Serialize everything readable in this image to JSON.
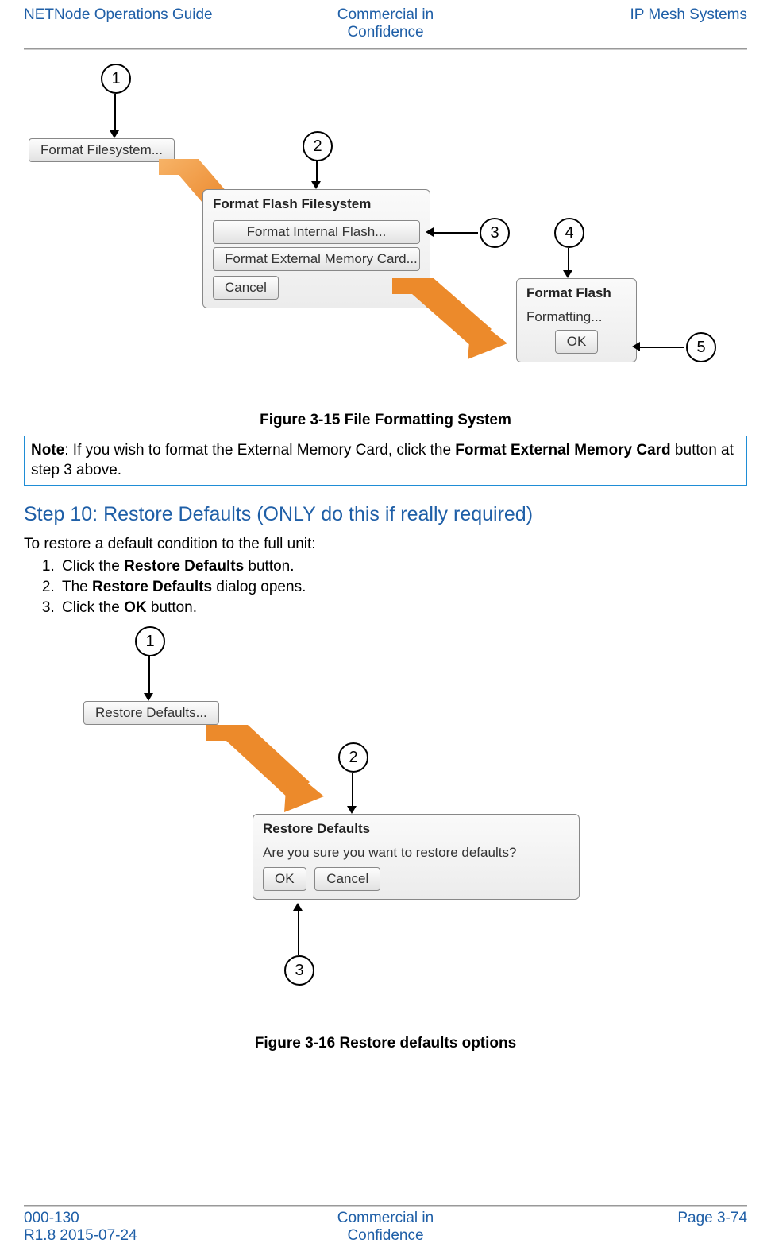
{
  "header": {
    "left": "NETNode Operations Guide",
    "center_l1": "Commercial in",
    "center_l2": "Confidence",
    "right": "IP Mesh Systems"
  },
  "footer": {
    "left_l1": "000-130",
    "left_l2": "R1.8 2015-07-24",
    "center_l1": "Commercial in",
    "center_l2": "Confidence",
    "right": "Page 3-74"
  },
  "fig1": {
    "callout1": "1",
    "callout2": "2",
    "callout3": "3",
    "callout4": "4",
    "callout5": "5",
    "btn_format_fs": "Format Filesystem...",
    "panel_title": "Format Flash Filesystem",
    "btn_internal": "Format Internal Flash...",
    "btn_external": "Format External Memory Card...",
    "btn_cancel": "Cancel",
    "panel2_title": "Format Flash",
    "panel2_msg": "Formatting...",
    "btn_ok": "OK",
    "caption": "Figure 3-15 File Formatting System"
  },
  "note": {
    "prefix": "Note",
    "text1": ": If you wish to format the External Memory Card, click the ",
    "bold1": "Format External Memory Card",
    "text2": " button at step 3 above."
  },
  "step_heading": "Step 10: Restore Defaults (ONLY do this if really required)",
  "intro": "To restore a default condition to the full unit:",
  "list": {
    "i1_a": "Click the ",
    "i1_b": "Restore Defaults",
    "i1_c": " button.",
    "i2_a": "The ",
    "i2_b": "Restore Defaults",
    "i2_c": " dialog opens.",
    "i3_a": "Click the ",
    "i3_b": "OK",
    "i3_c": " button."
  },
  "fig2": {
    "callout1": "1",
    "callout2": "2",
    "callout3": "3",
    "btn_restore": "Restore Defaults...",
    "panel_title": "Restore Defaults",
    "msg": "Are you sure you want to restore defaults?",
    "btn_ok": "OK",
    "btn_cancel": "Cancel",
    "caption": "Figure 3-16 Restore defaults options"
  }
}
